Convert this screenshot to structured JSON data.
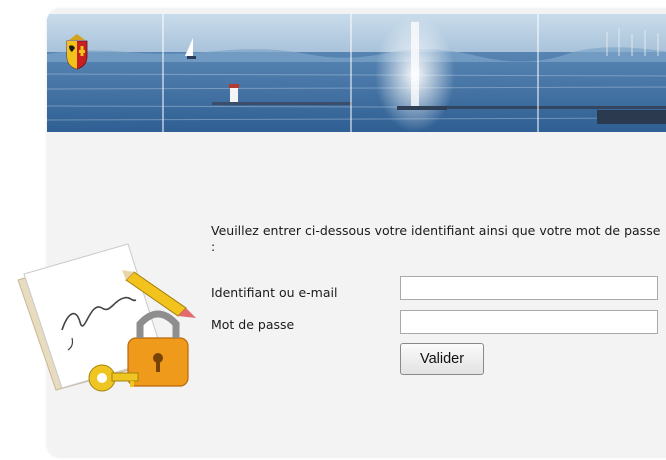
{
  "login": {
    "intro": "Veuillez entrer ci-dessous votre identifiant ainsi que votre mot de passe :",
    "identifier_label": "Identifiant ou e-mail",
    "identifier_value": "",
    "password_label": "Mot de passe",
    "password_value": "",
    "submit_label": "Valider"
  },
  "icons": {
    "logo": "geneva-coat-of-arms-icon",
    "illustration": "signature-lock-key-icon"
  },
  "colors": {
    "panel": "#f3f3f3",
    "banner_sky": "#bcd3e6",
    "banner_water": "#4d80b3"
  }
}
